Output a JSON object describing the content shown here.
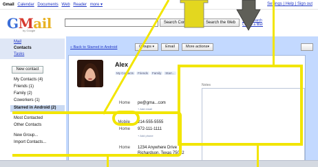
{
  "topbar": {
    "brand": "Gmail",
    "links": [
      "Calendar",
      "Documents",
      "Web",
      "Reader",
      "more ▾"
    ],
    "right_links": "Settings | Help | Sign out"
  },
  "logo": {
    "text": "GMail",
    "subtitle": "by Google"
  },
  "search": {
    "mail_button": "Search Contacts",
    "web_button": "Search the Web",
    "options": [
      "Show search",
      "Create a filter"
    ]
  },
  "sidebar": {
    "nav": [
      "Mail",
      "Contacts",
      "Tasks"
    ],
    "new_contact": "New contact",
    "groups": [
      "My Contacts (4)",
      "Friends (1)",
      "Family (2)",
      "Coworkers (1)",
      "Starred in Android (2)"
    ],
    "more": [
      "Most Contacted",
      "Other Contacts"
    ],
    "actions": [
      "New Group...",
      "Import Contacts..."
    ]
  },
  "toolbar": {
    "back": "« Back to Starred in Android",
    "groups": "Groups",
    "email": "Email",
    "more_actions": "More actions"
  },
  "contact": {
    "name": "Alex",
    "tags": [
      "My Contacts",
      "Friends",
      "Family",
      "Starr..."
    ],
    "fields": [
      {
        "label": "Home",
        "value": "pe@gma...com"
      },
      {
        "label": "Mobile",
        "value": "214-555-5555"
      },
      {
        "label": "Home",
        "value": "972-111-1111"
      },
      {
        "label": "Home",
        "value": "1234 Anywhere Drive"
      }
    ],
    "add_email": "Add email",
    "add_phone": "Add phone",
    "address_line2": "Richardson, Texas 75082",
    "notes_label": "Notes"
  },
  "colors": {
    "annotation": "#f2e500",
    "toolbar_bg": "#c3d9ff",
    "selected": "#c9d9f2"
  }
}
